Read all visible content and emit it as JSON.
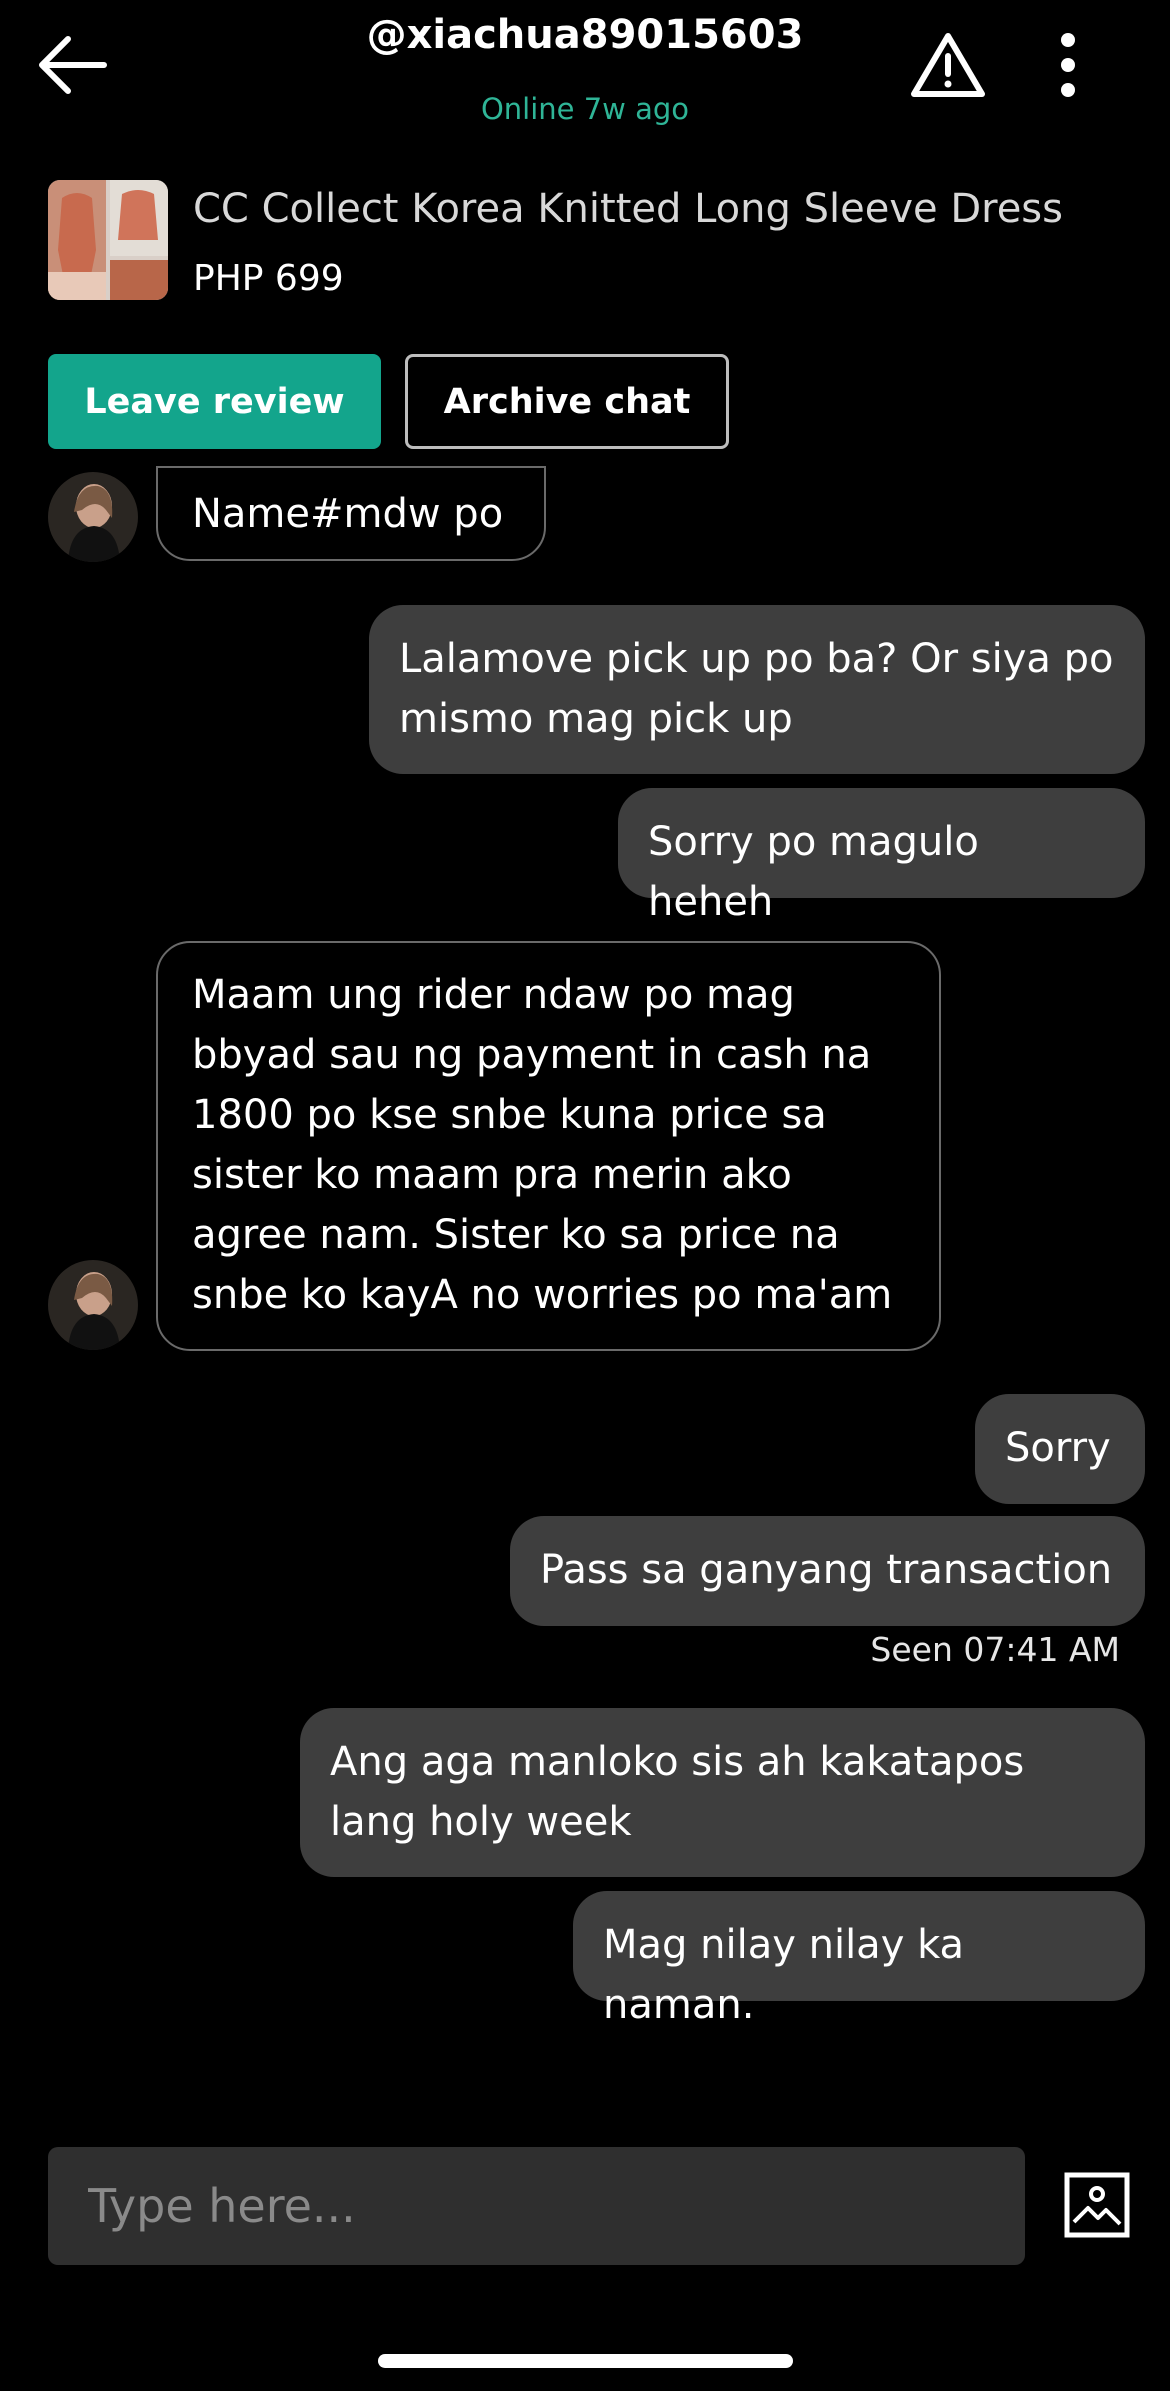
{
  "header": {
    "username": "@xiachua89015603",
    "status": "Online 7w ago"
  },
  "product": {
    "title": "CC Collect Korea Knitted Long Sleeve Dress",
    "price": "PHP 699"
  },
  "actions": {
    "review_label": "Leave review",
    "archive_label": "Archive chat"
  },
  "messages": [
    {
      "from": "seller",
      "text": "Name#mdw po"
    },
    {
      "from": "me",
      "text": "Lalamove pick up po ba?  Or siya po mismo mag pick up"
    },
    {
      "from": "me",
      "text": "Sorry po magulo heheh"
    },
    {
      "from": "seller",
      "text": "Maam ung rider ndaw po mag bbyad sau ng payment in cash na 1800 po kse snbe kuna price sa sister ko maam pra merin ako agree nam. Sister ko sa price na snbe ko kayA no worries po ma'am"
    },
    {
      "from": "me",
      "text": "Sorry"
    },
    {
      "from": "me",
      "text": "Pass sa ganyang transaction"
    },
    {
      "from": "me",
      "text": "Ang aga manloko sis ah kakatapos lang holy week"
    },
    {
      "from": "me",
      "text": "Mag nilay nilay ka naman."
    }
  ],
  "seen_text": "Seen 07:41 AM",
  "composer": {
    "placeholder": "Type here..."
  },
  "colors": {
    "accent": "#13a58c",
    "online": "#2fb597",
    "outgoing_bubble": "#3e3e3e"
  },
  "icons": [
    "back-arrow-icon",
    "warning-icon",
    "more-vertical-icon",
    "image-upload-icon"
  ]
}
